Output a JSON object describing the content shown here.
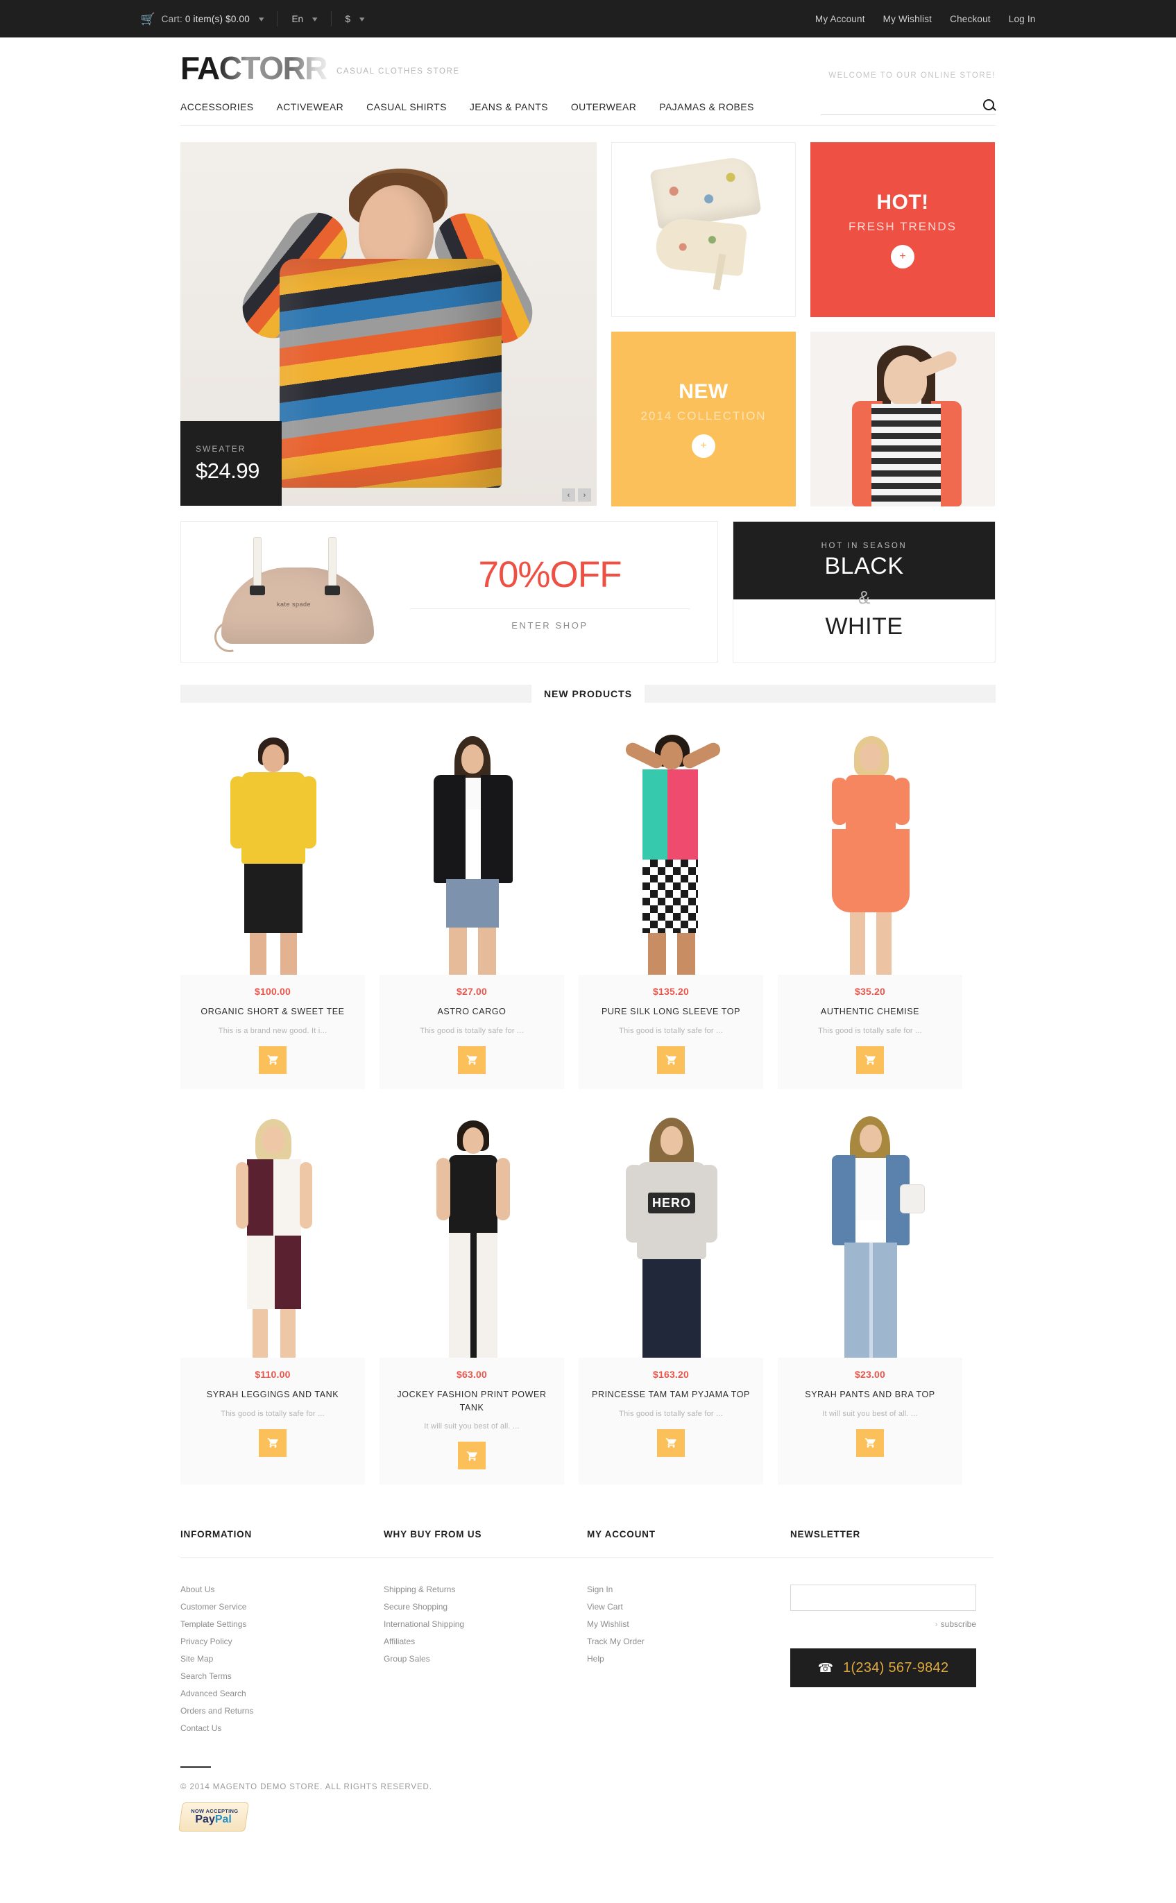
{
  "topbar": {
    "cart_icon": "cart-icon",
    "cart_label": "Cart:",
    "cart_value": "0 item(s) $0.00",
    "language": "En",
    "currency": "$",
    "links": [
      {
        "label": "My Account"
      },
      {
        "label": "My Wishlist"
      },
      {
        "label": "Checkout"
      },
      {
        "label": "Log In"
      }
    ]
  },
  "header": {
    "logo": "FACTORR",
    "tagline": "CASUAL CLOTHES STORE",
    "welcome": "WELCOME TO OUR ONLINE STORE!"
  },
  "nav": {
    "items": [
      {
        "label": "ACCESSORIES"
      },
      {
        "label": "ACTIVEWEAR"
      },
      {
        "label": "CASUAL SHIRTS"
      },
      {
        "label": "JEANS & PANTS"
      },
      {
        "label": "OUTERWEAR"
      },
      {
        "label": "PAJAMAS & ROBES"
      }
    ],
    "search_placeholder": "",
    "search_value": "",
    "search_icon": "search-icon"
  },
  "hero": {
    "caption_label": "SWEATER",
    "caption_price": "$24.99",
    "prev_arrow": "‹",
    "next_arrow": "›",
    "tiles": {
      "hot": {
        "title": "HOT!",
        "subtitle": "FRESH TRENDS",
        "button": "+"
      },
      "new": {
        "title": "NEW",
        "subtitle": "2014 COLLECTION",
        "button": "+"
      }
    }
  },
  "promos": {
    "sale": {
      "discount": "70%OFF",
      "cta": "ENTER SHOP"
    },
    "blackwhite": {
      "kicker": "HOT IN SEASON",
      "line1": "BLACK",
      "amp": "&",
      "line2": "WHITE"
    }
  },
  "section": {
    "title": "NEW PRODUCTS"
  },
  "products": [
    {
      "price": "$100.00",
      "name": "ORGANIC SHORT & SWEET TEE",
      "desc": "This is a brand new good. It i...",
      "cart": "add-to-cart"
    },
    {
      "price": "$27.00",
      "name": "ASTRO CARGO",
      "desc": "This good is totally safe for ...",
      "cart": "add-to-cart"
    },
    {
      "price": "$135.20",
      "name": "PURE SILK LONG SLEEVE TOP",
      "desc": "This good is totally safe for ...",
      "cart": "add-to-cart"
    },
    {
      "price": "$35.20",
      "name": "AUTHENTIC CHEMISE",
      "desc": "This good is totally safe for ...",
      "cart": "add-to-cart"
    },
    {
      "price": "$110.00",
      "name": "SYRAH LEGGINGS AND TANK",
      "desc": "This good is totally safe for ...",
      "cart": "add-to-cart"
    },
    {
      "price": "$63.00",
      "name": "JOCKEY FASHION PRINT POWER TANK",
      "desc": "It will suit you best of all. ...",
      "cart": "add-to-cart"
    },
    {
      "price": "$163.20",
      "name": "PRINCESSE TAM TAM PYJAMA TOP",
      "desc": "This good is totally safe for ...",
      "cart": "add-to-cart"
    },
    {
      "price": "$23.00",
      "name": "SYRAH PANTS AND BRA TOP",
      "desc": "It will suit you best of all. ...",
      "cart": "add-to-cart"
    }
  ],
  "footer": {
    "columns": [
      {
        "title": "INFORMATION",
        "links": [
          {
            "label": "About Us"
          },
          {
            "label": "Customer Service"
          },
          {
            "label": "Template Settings"
          },
          {
            "label": "Privacy Policy"
          },
          {
            "label": "Site Map"
          },
          {
            "label": "Search Terms"
          },
          {
            "label": "Advanced Search"
          },
          {
            "label": "Orders and Returns"
          },
          {
            "label": "Contact Us"
          }
        ]
      },
      {
        "title": "WHY BUY FROM US",
        "links": [
          {
            "label": "Shipping & Returns"
          },
          {
            "label": "Secure Shopping"
          },
          {
            "label": "International Shipping"
          },
          {
            "label": "Affiliates"
          },
          {
            "label": "Group Sales"
          }
        ]
      },
      {
        "title": "MY ACCOUNT",
        "links": [
          {
            "label": "Sign In"
          },
          {
            "label": "View Cart"
          },
          {
            "label": "My Wishlist"
          },
          {
            "label": "Track My Order"
          },
          {
            "label": "Help"
          }
        ]
      }
    ],
    "newsletter": {
      "title": "NEWSLETTER",
      "input_value": "",
      "input_placeholder": "",
      "subscribe_label": "subscribe",
      "phone_icon": "phone-icon",
      "phone": "1(234) 567-9842"
    },
    "copyright": "© 2014 MAGENTO DEMO STORE. ALL RIGHTS RESERVED.",
    "paypal": {
      "line1": "NOW ACCEPTING",
      "pay": "Pay",
      "pal": "Pal"
    }
  },
  "colors": {
    "accent_red": "#ee5043",
    "accent_yellow": "#fbc05a",
    "dark": "#1f1f1f",
    "gold": "#e0a93c"
  }
}
